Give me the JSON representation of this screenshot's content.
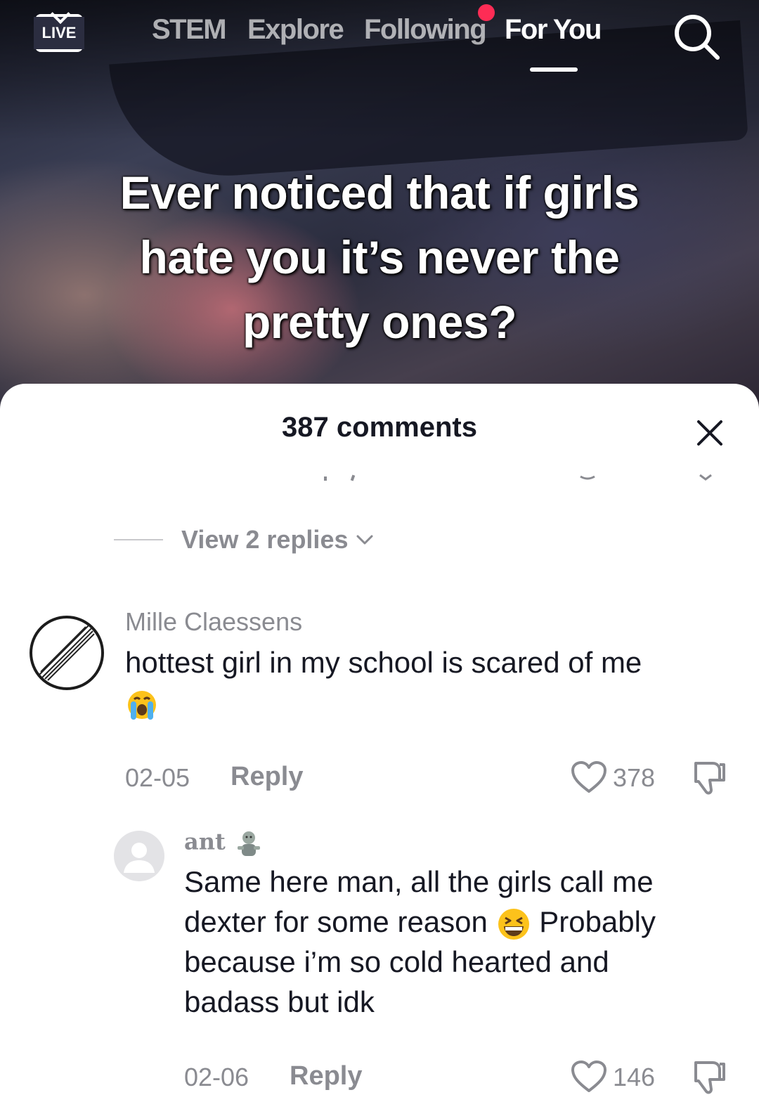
{
  "topnav": {
    "live_label": "LIVE",
    "tabs": [
      {
        "label": "STEM"
      },
      {
        "label": "Explore"
      },
      {
        "label": "Following"
      },
      {
        "label": "For You"
      }
    ],
    "active_tab": "For You",
    "accent_color": "#fe2c55",
    "search_icon": "search-icon"
  },
  "video": {
    "caption": "Ever noticed that if girls hate you it’s never the pretty ones?"
  },
  "comments_sheet": {
    "title": "387 comments",
    "close_icon": "close-icon",
    "view_replies_label": "View 2 replies",
    "comments": [
      {
        "username": "Mille Claessens",
        "text": "hottest girl in my school is scared of me",
        "emoji": "loudly-crying-face",
        "date": "02-05",
        "reply_label": "Reply",
        "likes": "378"
      },
      {
        "username": "ant",
        "username_emoji": "zombie",
        "text_line1": "Same here man, all the girls call me",
        "text_line2a": "dexter for some reason",
        "text_line2_emoji": "grinning-squinting-face",
        "text_line2b": "Probably",
        "text_line3": "because i’m so cold hearted and",
        "text_line4": "badass but idk",
        "date": "02-06",
        "reply_label": "Reply",
        "likes": "146"
      }
    ]
  }
}
